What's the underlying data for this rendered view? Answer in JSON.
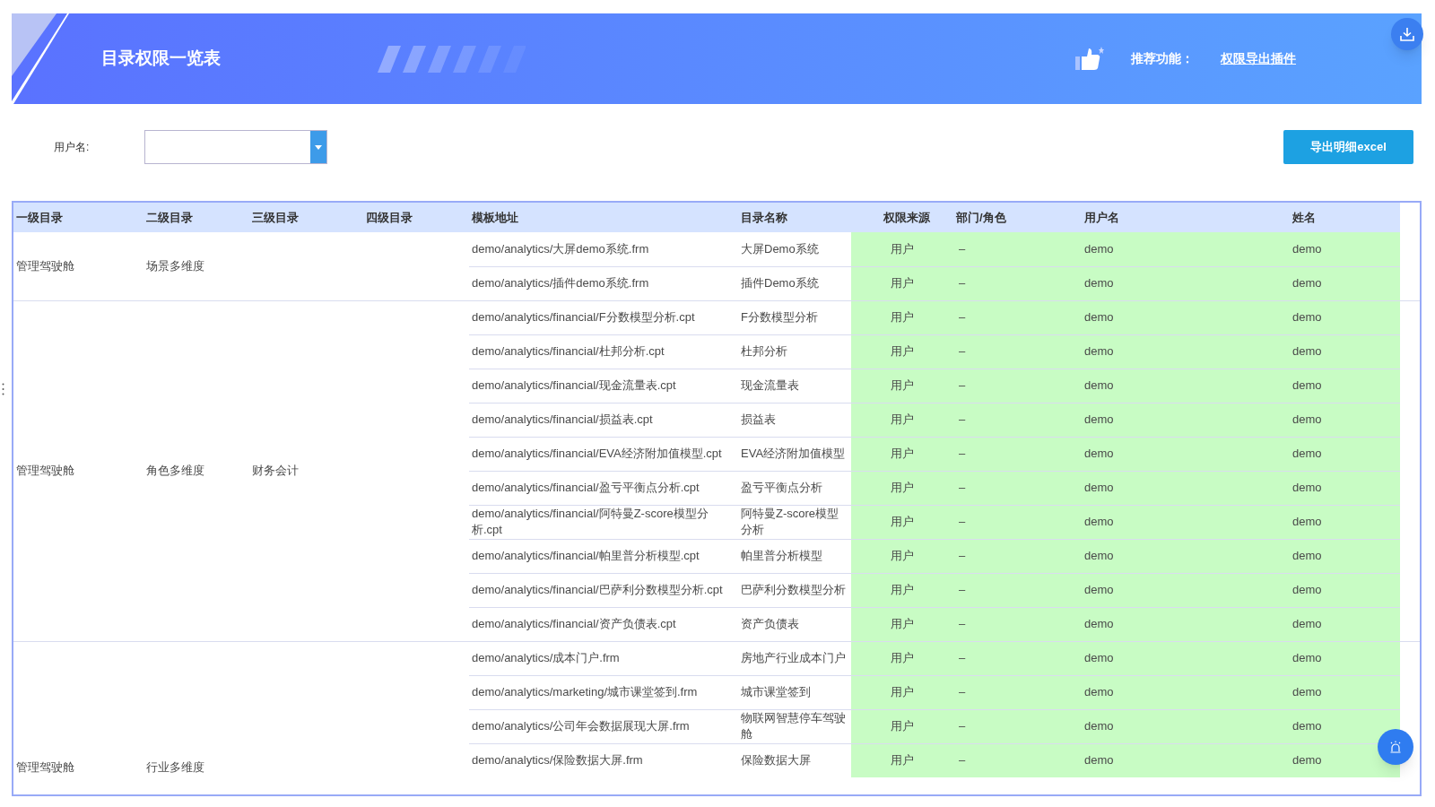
{
  "header": {
    "title": "目录权限一览表",
    "recommend_label": "推荐功能：",
    "recommend_link": "权限导出插件"
  },
  "filter": {
    "label": "用户名:"
  },
  "export_button": "导出明细excel",
  "table": {
    "columns": [
      "一级目录",
      "二级目录",
      "三级目录",
      "四级目录",
      "模板地址",
      "目录名称",
      "权限来源",
      "部门/角色",
      "用户名",
      "姓名"
    ],
    "groups": [
      {
        "level1": "管理驾驶舱",
        "level2": "场景多维度",
        "rows": [
          {
            "path": "demo/analytics/大屏demo系统.frm",
            "name": "大屏Demo系统",
            "source": "用户",
            "dept": "–",
            "user": "demo",
            "full_name": "demo"
          },
          {
            "path": "demo/analytics/插件demo系统.frm",
            "name": "插件Demo系统",
            "source": "用户",
            "dept": "–",
            "user": "demo",
            "full_name": "demo"
          }
        ]
      },
      {
        "level1": "管理驾驶舱",
        "level2": "角色多维度",
        "level3": "财务会计",
        "rows": [
          {
            "path": "demo/analytics/financial/F分数模型分析.cpt",
            "name": "F分数模型分析",
            "source": "用户",
            "dept": "–",
            "user": "demo",
            "full_name": "demo"
          },
          {
            "path": "demo/analytics/financial/杜邦分析.cpt",
            "name": "杜邦分析",
            "source": "用户",
            "dept": "–",
            "user": "demo",
            "full_name": "demo"
          },
          {
            "path": "demo/analytics/financial/现金流量表.cpt",
            "name": "现金流量表",
            "source": "用户",
            "dept": "–",
            "user": "demo",
            "full_name": "demo"
          },
          {
            "path": "demo/analytics/financial/损益表.cpt",
            "name": "损益表",
            "source": "用户",
            "dept": "–",
            "user": "demo",
            "full_name": "demo"
          },
          {
            "path": "demo/analytics/financial/EVA经济附加值模型.cpt",
            "name": "EVA经济附加值模型",
            "source": "用户",
            "dept": "–",
            "user": "demo",
            "full_name": "demo"
          },
          {
            "path": "demo/analytics/financial/盈亏平衡点分析.cpt",
            "name": "盈亏平衡点分析",
            "source": "用户",
            "dept": "–",
            "user": "demo",
            "full_name": "demo"
          },
          {
            "path": "demo/analytics/financial/阿特曼Z-score模型分析.cpt",
            "name": "阿特曼Z-score模型分析",
            "source": "用户",
            "dept": "–",
            "user": "demo",
            "full_name": "demo"
          },
          {
            "path": "demo/analytics/financial/帕里普分析模型.cpt",
            "name": "帕里普分析模型",
            "source": "用户",
            "dept": "–",
            "user": "demo",
            "full_name": "demo"
          },
          {
            "path": "demo/analytics/financial/巴萨利分数模型分析.cpt",
            "name": "巴萨利分数模型分析",
            "source": "用户",
            "dept": "–",
            "user": "demo",
            "full_name": "demo"
          },
          {
            "path": "demo/analytics/financial/资产负债表.cpt",
            "name": "资产负债表",
            "source": "用户",
            "dept": "–",
            "user": "demo",
            "full_name": "demo"
          }
        ]
      },
      {
        "level1": "管理驾驶舱",
        "level2": "行业多维度",
        "rows": [
          {
            "path": "demo/analytics/成本门户.frm",
            "name": "房地产行业成本门户",
            "source": "用户",
            "dept": "–",
            "user": "demo",
            "full_name": "demo"
          },
          {
            "path": "demo/analytics/marketing/城市课堂签到.frm",
            "name": "城市课堂签到",
            "source": "用户",
            "dept": "–",
            "user": "demo",
            "full_name": "demo"
          },
          {
            "path": "demo/analytics/公司年会数据展现大屏.frm",
            "name": "物联网智慧停车驾驶舱",
            "source": "用户",
            "dept": "–",
            "user": "demo",
            "full_name": "demo"
          },
          {
            "path": "demo/analytics/保险数据大屏.frm",
            "name": "保险数据大屏",
            "source": "用户",
            "dept": "–",
            "user": "demo",
            "full_name": "demo"
          }
        ]
      }
    ]
  }
}
